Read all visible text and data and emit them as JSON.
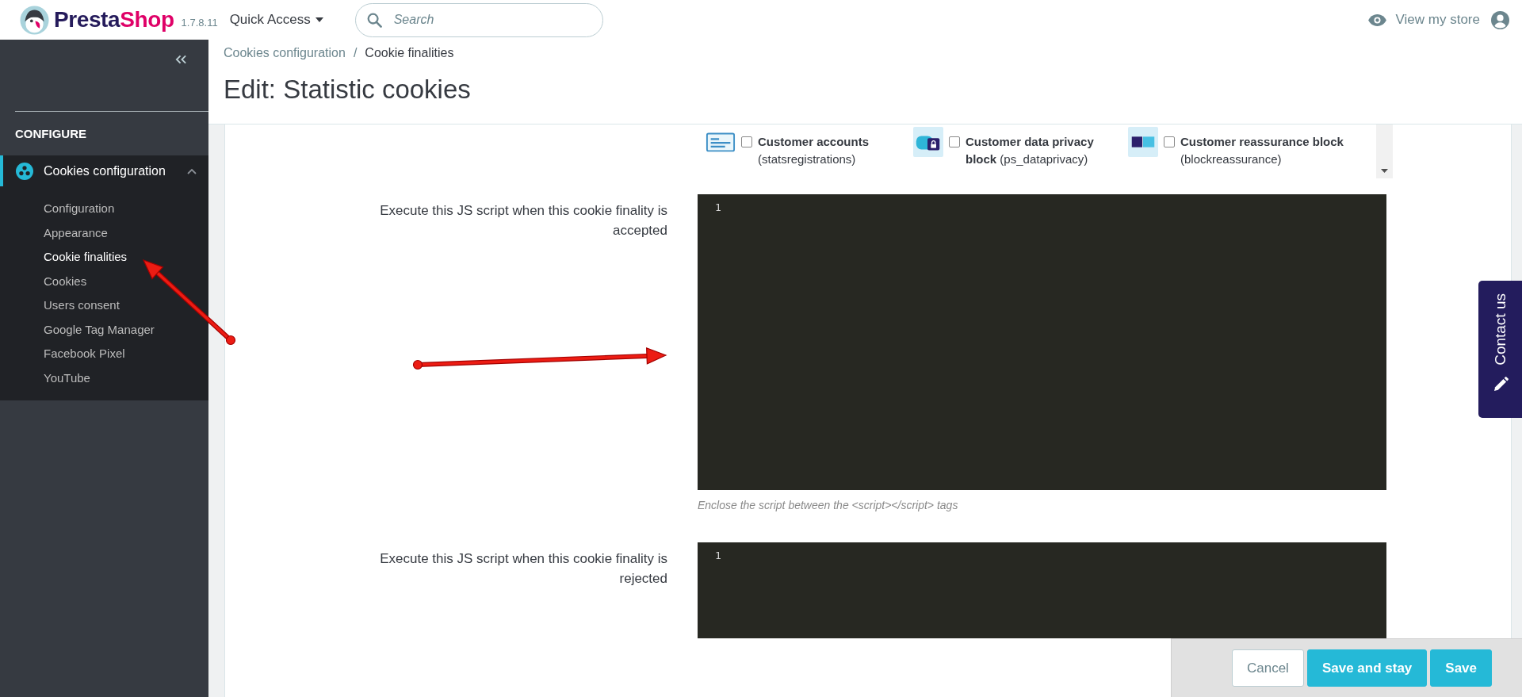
{
  "header": {
    "logo_text": "PrestaShop",
    "version": "1.7.8.11",
    "quick_access": "Quick Access",
    "search": {
      "placeholder": "Search"
    },
    "view_store": "View my store"
  },
  "sidebar": {
    "section_title": "CONFIGURE",
    "menu": [
      {
        "label": "Cookies configuration",
        "selected": true,
        "expanded": true,
        "children": [
          {
            "label": "Configuration",
            "selected": false
          },
          {
            "label": "Appearance",
            "selected": false
          },
          {
            "label": "Cookie finalities",
            "selected": true
          },
          {
            "label": "Cookies",
            "selected": false
          },
          {
            "label": "Users consent",
            "selected": false
          },
          {
            "label": "Google Tag Manager",
            "selected": false
          },
          {
            "label": "Facebook Pixel",
            "selected": false
          },
          {
            "label": "YouTube",
            "selected": false
          }
        ]
      }
    ]
  },
  "page": {
    "breadcrumb": {
      "separator": "/",
      "items": [
        {
          "label": "Cookies configuration",
          "current": false
        },
        {
          "label": "Cookie finalities",
          "current": true
        }
      ]
    },
    "title": "Edit: Statistic cookies"
  },
  "modules": [
    {
      "text": "**Customer accounts** (statsregistrations)",
      "checked": false
    },
    {
      "text": "**Customer data privacy block** (ps_dataprivacy)",
      "checked": false
    },
    {
      "text": "**Customer reassurance block** (blockreassurance)",
      "checked": false
    }
  ],
  "script_fields": [
    {
      "label": "Execute this JS script when this cookie finality is accepted",
      "line_numbers": [
        "1"
      ],
      "hint": "Enclose the script between the <script></script> tags"
    },
    {
      "label": "Execute this JS script when this cookie finality is rejected",
      "line_numbers": [
        "1"
      ]
    }
  ],
  "footer_buttons": [
    {
      "label": "Cancel",
      "kind": "secondary"
    },
    {
      "label": "Save and stay",
      "kind": "primary"
    },
    {
      "label": "Save",
      "kind": "primary"
    }
  ],
  "contact_tab": {
    "label": "Contact us"
  },
  "annotations": [
    {
      "kind": "arrow"
    },
    {
      "kind": "arrow"
    }
  ]
}
